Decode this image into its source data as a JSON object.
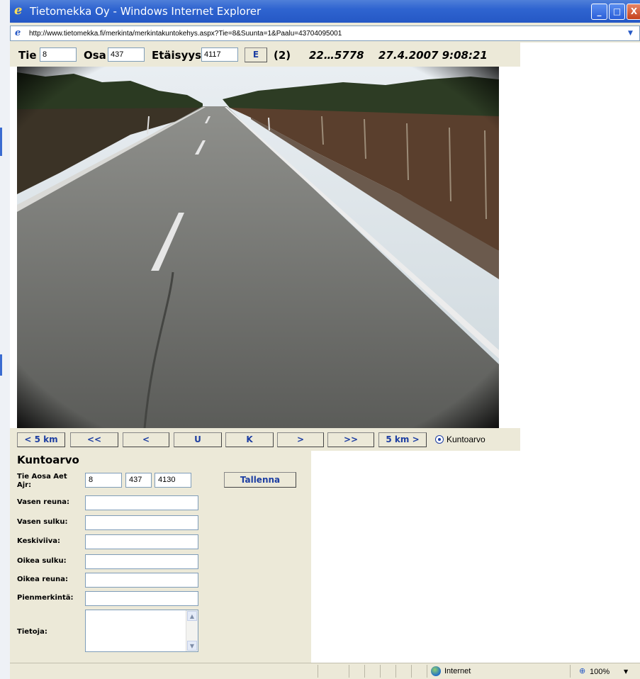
{
  "window": {
    "title": "Tietomekka Oy - Windows Internet Explorer",
    "minimize_glyph": "_",
    "maximize_glyph": "□",
    "close_glyph": "X"
  },
  "address": {
    "url": "http://www.tietomekka.fi/merkinta/merkintakuntokehys.aspx?Tie=8&Suunta=1&Paalu=43704095001"
  },
  "header": {
    "tie_label": "Tie",
    "tie_value": "8",
    "osa_label": "Osa",
    "osa_value": "437",
    "etaisyys_label": "Etäisyys",
    "etaisyys_value": "4117",
    "e_button": "E",
    "count": "(2)",
    "id_code": "22…5778",
    "datetime": "27.4.2007 9:08:21"
  },
  "nav": {
    "back5": "< 5 km",
    "fast_back": "<<",
    "back": "<",
    "u": "U",
    "k": "K",
    "forward": ">",
    "fast_forward": ">>",
    "forward5": "5 km >",
    "radio_label": "Kuntoarvo",
    "radio_selected": true
  },
  "form": {
    "title": "Kuntoarvo",
    "ids_label": "Tie Aosa Aet Ajr:",
    "tie": "8",
    "aosa": "437",
    "aet": "4130",
    "save_button": "Tallenna",
    "fields": [
      {
        "label": "Vasen reuna:",
        "value": ""
      },
      {
        "label": "Vasen sulku:",
        "value": ""
      },
      {
        "label": "Keskiviiva:",
        "value": ""
      },
      {
        "label": "Oikea sulku:",
        "value": ""
      },
      {
        "label": "Oikea reuna:",
        "value": ""
      },
      {
        "label": "Pienmerkintä:",
        "value": ""
      }
    ],
    "notes_label": "Tietoja:",
    "notes_value": ""
  },
  "status": {
    "zone": "Internet",
    "zoom": "100%"
  },
  "colors": {
    "titlebar": "#2558c5",
    "button_text": "#1d3ea2",
    "panel": "#ece9d8"
  }
}
